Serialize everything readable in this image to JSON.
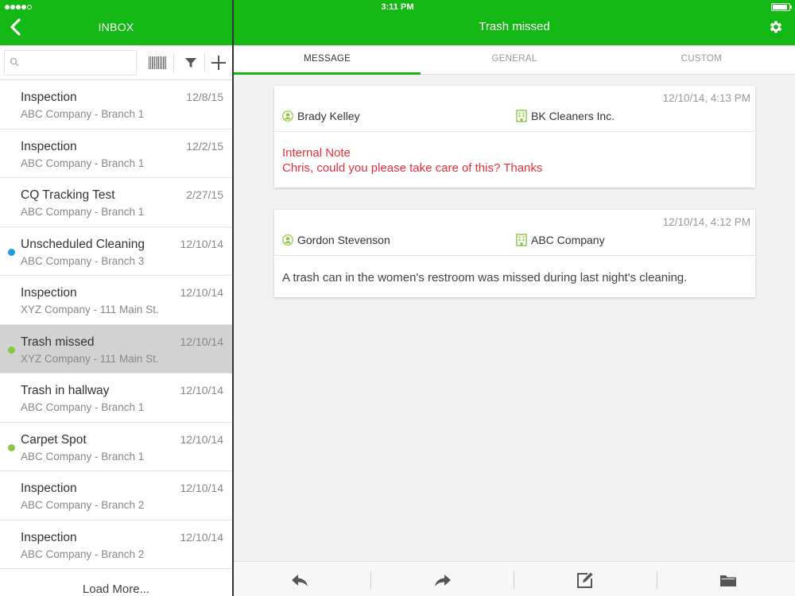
{
  "status": {
    "time": "3:11 PM"
  },
  "header": {
    "inbox_title": "INBOX",
    "main_title": "Trash missed"
  },
  "search": {
    "placeholder": ""
  },
  "tabs": [
    {
      "label": "MESSAGE",
      "active": true
    },
    {
      "label": "GENERAL",
      "active": false
    },
    {
      "label": "CUSTOM",
      "active": false
    }
  ],
  "inbox": {
    "items": [
      {
        "title": "Inspection",
        "subtitle": "ABC Company - Branch 1",
        "date": "12/8/15",
        "dot": ""
      },
      {
        "title": "Inspection",
        "subtitle": "ABC Company - Branch 1",
        "date": "12/2/15",
        "dot": ""
      },
      {
        "title": "CQ Tracking Test",
        "subtitle": "ABC Company - Branch 1",
        "date": "2/27/15",
        "dot": ""
      },
      {
        "title": "Unscheduled Cleaning",
        "subtitle": "ABC Company - Branch 3",
        "date": "12/10/14",
        "dot": "#1a9de0"
      },
      {
        "title": "Inspection",
        "subtitle": "XYZ Company - 111 Main St.",
        "date": "12/10/14",
        "dot": ""
      },
      {
        "title": "Trash missed",
        "subtitle": "XYZ Company - 111 Main St.",
        "date": "12/10/14",
        "dot": "#8cc63f",
        "selected": true
      },
      {
        "title": "Trash in hallway",
        "subtitle": "ABC Company - Branch 1",
        "date": "12/10/14",
        "dot": ""
      },
      {
        "title": "Carpet Spot",
        "subtitle": "ABC Company - Branch 1",
        "date": "12/10/14",
        "dot": "#8cc63f"
      },
      {
        "title": "Inspection",
        "subtitle": "ABC Company - Branch 2",
        "date": "12/10/14",
        "dot": ""
      },
      {
        "title": "Inspection",
        "subtitle": "ABC Company - Branch 2",
        "date": "12/10/14",
        "dot": ""
      }
    ],
    "load_more": "Load More..."
  },
  "messages": [
    {
      "timestamp": "12/10/14, 4:13 PM",
      "person": "Brady Kelley",
      "company": "BK Cleaners Inc.",
      "line1": "Internal Note",
      "line2": "Chris, could you please take care of this? Thanks"
    },
    {
      "timestamp": "12/10/14, 4:12 PM",
      "person": "Gordon Stevenson",
      "company": "ABC Company",
      "line1": "A trash can in the women's restroom was missed during last night's cleaning."
    }
  ],
  "colors": {
    "brand": "#14b814",
    "note_red": "#e8303a",
    "unread_blue": "#1a9de0",
    "unread_green": "#8cc63f"
  },
  "icons": [
    "back-icon",
    "gear-icon",
    "search-icon",
    "barcode-icon",
    "filter-icon",
    "add-icon",
    "reply-icon",
    "forward-icon",
    "edit-icon",
    "folder-icon",
    "person-icon",
    "building-icon"
  ]
}
